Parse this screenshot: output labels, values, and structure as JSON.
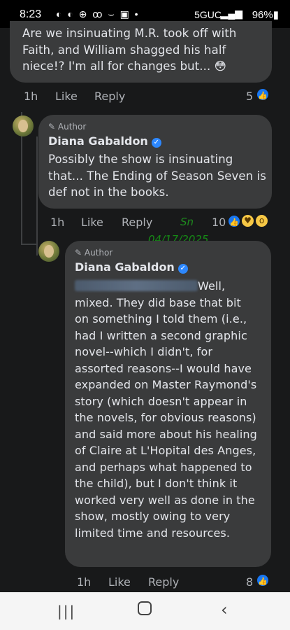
{
  "status_bar": {
    "time": "8:23",
    "notification_icons": "◐ ◐ ⊕ ꝏ ⌣ ▣ •",
    "network": "5GUC",
    "battery": "96%"
  },
  "comment1": {
    "line1": "Are we insinuating M.R. took off with",
    "line2": "Faith, and William shagged his half",
    "line3": "niece!? I'm all for changes but... 😳",
    "time": "1h",
    "like": "Like",
    "reply": "Reply",
    "reactions": "5"
  },
  "reply1": {
    "badge": "Author",
    "author": "Diana Gabaldon",
    "line1": "Possibly the show is insinuating",
    "line2": "that...  The Ending of Season Seven is",
    "line3": "def not in the books.",
    "time": "1h",
    "like": "Like",
    "reply": "Reply",
    "reactions": "10"
  },
  "watermark": {
    "initials": "Sn",
    "date": "04/17/2025"
  },
  "reply2": {
    "badge": "Author",
    "author": "Diana Gabaldon",
    "line1_end": "Well,",
    "line2": "mixed.   They did base that bit",
    "line3": "on something I told them (i.e.,",
    "line4": "had I written a second graphic",
    "line5": "novel--which I didn't, for",
    "line6": "assorted reasons--I would have",
    "line7": "expanded on Master Raymond's",
    "line8": "story (which doesn't appear in",
    "line9": "the novels, for obvious reasons)",
    "line10": "and said more about his healing",
    "line11": "of Claire at L'Hopital des Anges,",
    "line12": "and perhaps what happened to",
    "line13": "the child), but I don't think it",
    "line14": "worked very well as done in the",
    "line15": "show, mostly owing to very",
    "line16": "limited time and resources.",
    "time": "1h",
    "like": "Like",
    "reply": "Reply",
    "reactions": "8"
  }
}
